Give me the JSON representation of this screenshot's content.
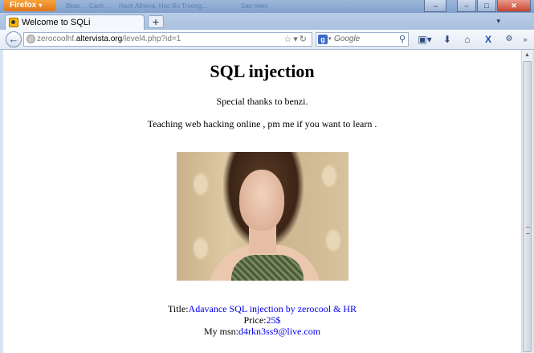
{
  "browser": {
    "menu_label": "Firefox",
    "ghost_titles": [
      "Bkav ... Cach ...",
      "Hack Athena, Hoc Bo Truong...",
      "Sao mien",
      "Welcome to SQLi"
    ],
    "tab_title": "Welcome to SQLi",
    "new_tab": "+",
    "url_prefix": "zerocoolhf.",
    "url_host": "altervista.org",
    "url_path": "/level4.php?id=1",
    "search_placeholder": "Google",
    "search_engine_letter": "g"
  },
  "page": {
    "heading": "SQL injection",
    "thanks": "Special thanks to benzi.",
    "teaching": "Teaching web hacking online , pm me if you want to learn .",
    "title_label": "Title:",
    "title_value": "Adavance SQL injection by zerocool & HR",
    "price_label": "Price:",
    "price_value": "25$",
    "msn_label": "My msn:",
    "msn_value": "d4rkn3ss9@live.com"
  },
  "icons": [
    "firefox-logo-icon",
    "favicon-icon",
    "back-icon",
    "globe-icon",
    "bookmark-star-icon",
    "reload-icon",
    "search-icon",
    "bookmarks-icon",
    "download-icon",
    "home-icon",
    "addon-x-icon",
    "settings-icon"
  ]
}
